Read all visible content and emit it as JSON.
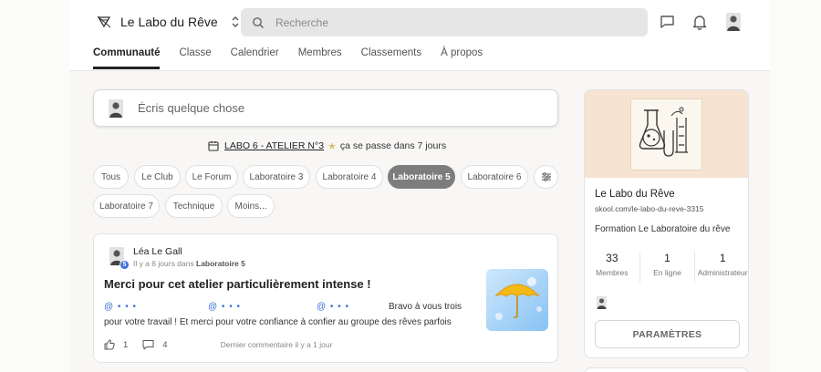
{
  "header": {
    "community_name": "Le Labo du Rêve",
    "search_placeholder": "Recherche"
  },
  "tabs": [
    {
      "label": "Communauté",
      "active": true
    },
    {
      "label": "Classe"
    },
    {
      "label": "Calendrier"
    },
    {
      "label": "Membres"
    },
    {
      "label": "Classements"
    },
    {
      "label": "À propos"
    }
  ],
  "composer": {
    "placeholder": "Écris quelque chose"
  },
  "event": {
    "link": "LABO 6 - ATELIER N°3",
    "suffix": "ça se passe dans 7 jours"
  },
  "categories": [
    {
      "label": "Tous"
    },
    {
      "label": "Le Club"
    },
    {
      "label": "Le Forum"
    },
    {
      "label": "Laboratoire 3"
    },
    {
      "label": "Laboratoire 4"
    },
    {
      "label": "Laboratoire 5",
      "active": true
    },
    {
      "label": "Laboratoire 6"
    },
    {
      "label": "Laboratoire 7"
    },
    {
      "label": "Technique"
    },
    {
      "label": "Moins..."
    }
  ],
  "post": {
    "author": "Léa  Le Gall",
    "level": "5",
    "meta_prefix": "Il y a 6 jours dans",
    "meta_category": "Laboratoire 5",
    "title": "Merci pour cet atelier particulièrement intense !",
    "mention": "@ • • •",
    "body_line1_end": "Bravo à vous trois",
    "body_line2": "pour votre travail ! Et merci pour votre confiance à confier au groupe des rêves parfois",
    "likes": "1",
    "comments": "4",
    "last_comment": "Dernier commentaire il y a 1 jour"
  },
  "sidebar": {
    "name": "Le Labo du Rêve",
    "url": "skool.com/le-labo-du-reve-3315",
    "description": "Formation Le Laboratoire du rêve",
    "stats": [
      {
        "value": "33",
        "label": "Membres"
      },
      {
        "value": "1",
        "label": "En ligne"
      },
      {
        "value": "1",
        "label": "Administrateur"
      }
    ],
    "settings_button": "PARAMÈTRES"
  },
  "colors": {
    "active_chip": "#7d7d7d",
    "cover_bg": "#f7e3d1",
    "level_badge": "#3b6fd8"
  }
}
